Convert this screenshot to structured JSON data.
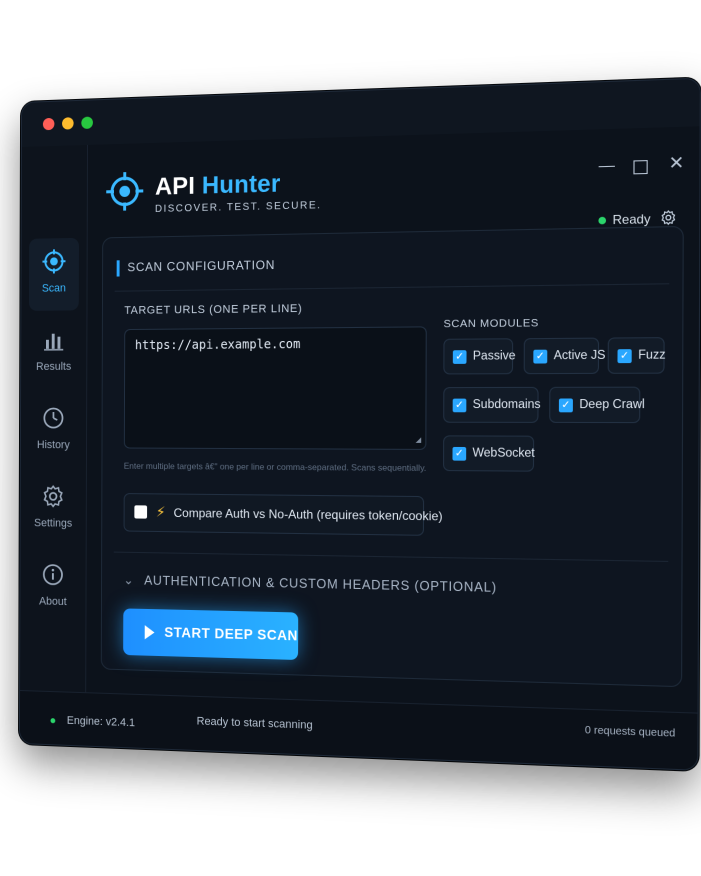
{
  "app": {
    "title_part1": "API ",
    "title_part2": "Hunter",
    "tagline": "DISCOVER. TEST. SECURE.",
    "status": "Ready",
    "accent_color": "#2aa7ff"
  },
  "window_controls": {
    "minimize": "—",
    "close": "✕"
  },
  "sidebar": {
    "items": [
      {
        "label": "Scan",
        "icon": "target-icon",
        "active": true
      },
      {
        "label": "Results",
        "icon": "bar-chart-icon",
        "active": false
      },
      {
        "label": "History",
        "icon": "clock-icon",
        "active": false
      },
      {
        "label": "Settings",
        "icon": "gear-icon",
        "active": false
      },
      {
        "label": "About",
        "icon": "info-icon",
        "active": false
      }
    ]
  },
  "scan_config": {
    "heading": "SCAN CONFIGURATION",
    "urls_label": "TARGET URLS (ONE PER LINE)",
    "urls_value": "https://api.example.com",
    "hint": "Enter multiple targets â€\" one per line or comma-separated. Scans sequentially.",
    "compare_label": "Compare Auth vs No-Auth (requires token/cookie)",
    "compare_checked": false,
    "modules_label": "SCAN MODULES",
    "modules": [
      {
        "label": "Passive",
        "checked": true
      },
      {
        "label": "Active JS",
        "checked": true
      },
      {
        "label": "Fuzz",
        "checked": true
      },
      {
        "label": "Subdomains",
        "checked": true
      },
      {
        "label": "Deep Crawl",
        "checked": true
      },
      {
        "label": "WebSocket",
        "checked": true
      }
    ],
    "auth_section": "AUTHENTICATION & CUSTOM HEADERS (OPTIONAL)",
    "start_button": "START DEEP SCAN"
  },
  "footer": {
    "engine": "Engine: v2.4.1",
    "status_text": "Ready to start scanning",
    "queue": "0 requests queued"
  }
}
